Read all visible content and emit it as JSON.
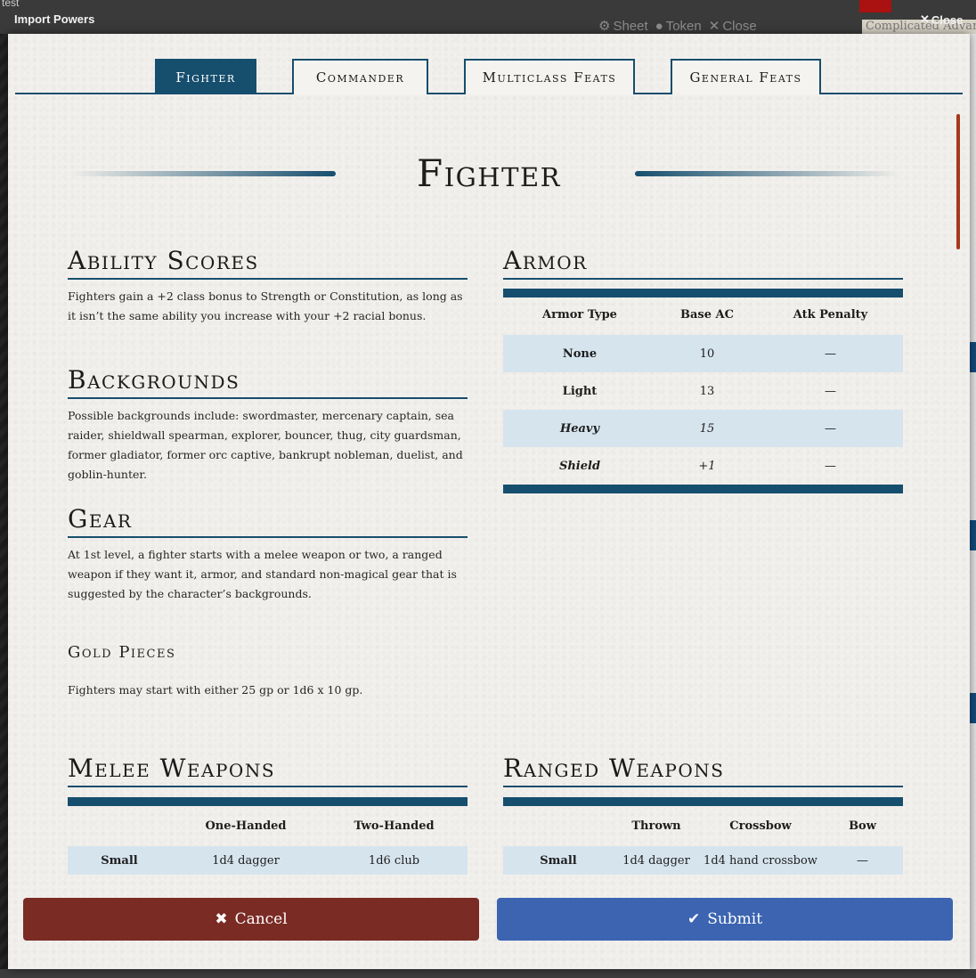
{
  "background": {
    "user": "test",
    "sheet_bar": {
      "sheet": "Sheet",
      "token": "Token",
      "close": "Close"
    },
    "complicated_text": "Complicated Advan"
  },
  "dialog": {
    "title": "Import Powers",
    "close_label": "Close"
  },
  "tabs": [
    {
      "label": "Fighter",
      "active": true
    },
    {
      "label": "Commander",
      "active": false
    },
    {
      "label": "Multiclass Feats",
      "active": false
    },
    {
      "label": "General Feats",
      "active": false
    }
  ],
  "page": {
    "title": "Fighter",
    "ability_scores": {
      "heading": "Ability Scores",
      "text": "Fighters gain a +2 class bonus to Strength or Constitution, as long as it isn’t the same ability you increase with your +2 racial bonus."
    },
    "backgrounds": {
      "heading": "Backgrounds",
      "text": "Possible backgrounds include: swordmaster, mercenary captain, sea raider, shieldwall spearman, explorer, bouncer, thug, city guardsman, former gladiator, former orc captive, bankrupt nobleman, duelist, and goblin-hunter."
    },
    "gear": {
      "heading": "Gear",
      "text": "At 1st level, a fighter starts with a melee weapon or two, a ranged weapon if they want it, armor, and standard non-magical gear that is suggested by the character’s backgrounds."
    },
    "gold": {
      "heading": "Gold Pieces",
      "text": "Fighters may start with either 25 gp or 1d6 x 10 gp."
    },
    "armor": {
      "heading": "Armor",
      "columns": [
        "Armor Type",
        "Base AC",
        "Atk Penalty"
      ],
      "rows": [
        [
          "None",
          "10",
          "—"
        ],
        [
          "Light",
          "13",
          "—"
        ],
        [
          "Heavy",
          "15",
          "—"
        ],
        [
          "Shield",
          "+1",
          "—"
        ]
      ]
    },
    "melee": {
      "heading": "Melee Weapons",
      "columns": [
        "",
        "One-Handed",
        "Two-Handed"
      ],
      "rows": [
        [
          "Small",
          "1d4 dagger",
          "1d6 club"
        ]
      ]
    },
    "ranged": {
      "heading": "Ranged Weapons",
      "columns": [
        "",
        "Thrown",
        "Crossbow",
        "Bow"
      ],
      "rows": [
        [
          "Small",
          "1d4 dagger",
          "1d4 hand crossbow",
          "—"
        ]
      ]
    }
  },
  "footer": {
    "cancel": "Cancel",
    "submit": "Submit"
  },
  "colors": {
    "accent": "#164e6e",
    "row_alt": "#d6e4ee",
    "cancel": "#7a2b24",
    "submit": "#3c64b1"
  }
}
